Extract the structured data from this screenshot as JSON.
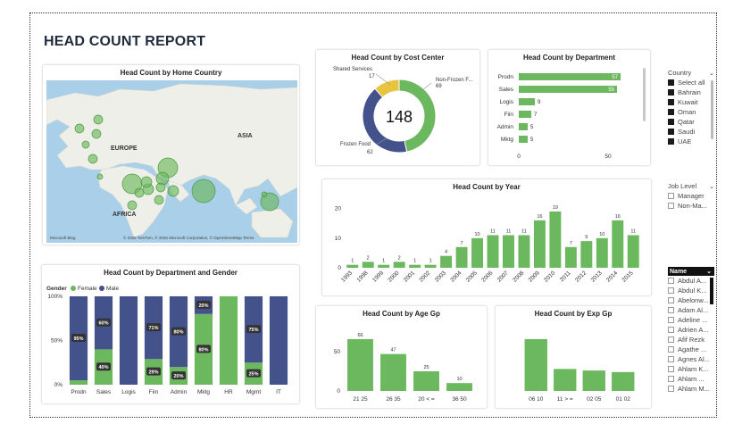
{
  "report": {
    "title": "HEAD COUNT REPORT"
  },
  "map": {
    "title": "Head Count by Home Country",
    "labels": {
      "europe": "EUROPE",
      "asia": "ASIA",
      "africa": "AFRICA"
    },
    "attribution": "© 2025 TomTom, © 2025 Microsoft Corporation, © OpenStreetMap  Terms",
    "brand": "Microsoft Bing"
  },
  "cost_center": {
    "title": "Head Count by Cost Center",
    "total": "148",
    "segments": [
      {
        "name": "Non-Frozen F...",
        "value": 69,
        "color": "#6cb85e"
      },
      {
        "name": "Frozen Food",
        "value": 62,
        "color": "#44528c"
      },
      {
        "name": "Shared Services",
        "value": 17,
        "color": "#e9c440"
      }
    ]
  },
  "department": {
    "title": "Head Count by Department",
    "axis_ticks": [
      "0",
      "50"
    ],
    "bars": [
      {
        "label": "Prodn",
        "value": 57
      },
      {
        "label": "Sales",
        "value": 55
      },
      {
        "label": "Logis",
        "value": 9
      },
      {
        "label": "Fiin",
        "value": 7
      },
      {
        "label": "Admin",
        "value": 5
      },
      {
        "label": "Mktg",
        "value": 5
      }
    ]
  },
  "country_slicer": {
    "header": "Country",
    "items": [
      "Select all",
      "Bahrain",
      "Kuwait",
      "Oman",
      "Qatar",
      "Saudi",
      "UAE"
    ]
  },
  "job_slicer": {
    "header": "Job Level",
    "items": [
      "Manager",
      "Non-Ma..."
    ]
  },
  "name_slicer": {
    "header": "Name",
    "items": [
      "Abdul A...",
      "Abdul K...",
      "Abelonw...",
      "Adam Al...",
      "Adeline ...",
      "Adrien A...",
      "Afif Rezk",
      "Agathe ...",
      "Agnes Al...",
      "Ahlam K...",
      "Ahlam ...",
      "Ahlam M..."
    ]
  },
  "year": {
    "title": "Head Count by Year",
    "axis_ticks": [
      "0",
      "10",
      "20"
    ],
    "chart_data": {
      "type": "bar",
      "categories": [
        "1993",
        "1998",
        "1999",
        "2000",
        "2001",
        "2002",
        "2003",
        "2004",
        "2005",
        "2006",
        "2007",
        "2008",
        "2009",
        "2010",
        "2011",
        "2012",
        "2013",
        "2014",
        "2015"
      ],
      "values": [
        1,
        2,
        1,
        2,
        1,
        1,
        4,
        7,
        10,
        11,
        11,
        11,
        16,
        19,
        7,
        9,
        10,
        16,
        11
      ],
      "ylim": [
        0,
        22
      ]
    }
  },
  "gender": {
    "title": "Head Count by Department and Gender",
    "legend_title": "Gender",
    "legend": [
      {
        "name": "Female",
        "color": "#6cb85e"
      },
      {
        "name": "Male",
        "color": "#44528c"
      }
    ],
    "axis_ticks": [
      "0%",
      "50%",
      "100%"
    ],
    "chart_data": {
      "type": "bar",
      "categories": [
        "Prodn",
        "Sales",
        "Logis",
        "Fiin",
        "Admin",
        "Mktg",
        "HR",
        "Mgmt",
        "IT"
      ],
      "series": [
        {
          "name": "Female",
          "values": [
            5,
            40,
            0,
            29,
            20,
            80,
            100,
            25,
            0
          ],
          "labels": [
            "",
            "40%",
            "",
            "29%",
            "20%",
            "80%",
            "",
            "25%",
            ""
          ]
        },
        {
          "name": "Male",
          "values": [
            95,
            60,
            100,
            71,
            80,
            20,
            0,
            75,
            100
          ],
          "labels": [
            "95%",
            "60%",
            "",
            "71%",
            "80%",
            "20%",
            "",
            "75%",
            ""
          ]
        }
      ],
      "ylim": [
        0,
        100
      ]
    }
  },
  "age": {
    "title": "Head Count by Age Gp",
    "axis_ticks": [
      "0",
      "50"
    ],
    "chart_data": {
      "type": "bar",
      "categories": [
        "21 25",
        "26 35",
        "20 < =",
        "36 50"
      ],
      "values": [
        66,
        47,
        25,
        10
      ],
      "ylim": [
        0,
        75
      ]
    }
  },
  "exp": {
    "title": "Head Count by Exp Gp",
    "chart_data": {
      "type": "bar",
      "categories": [
        "06 10",
        "11 > =",
        "02 05",
        "01 02"
      ],
      "values": [
        66,
        28,
        26,
        24
      ],
      "ylim": [
        0,
        75
      ]
    }
  }
}
